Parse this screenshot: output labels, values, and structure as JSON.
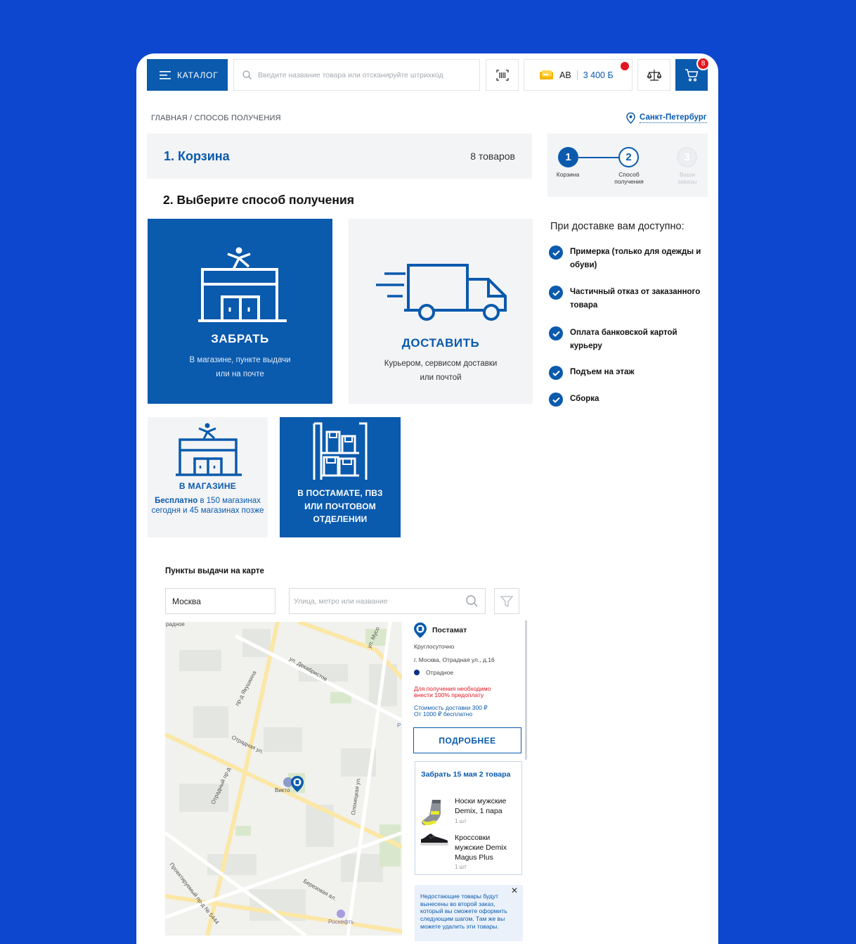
{
  "header": {
    "catalog_label": "КАТАЛОГ",
    "search_placeholder": "Введите название товара или отсканируйте штрихкод",
    "bonus_prefix": "АВ",
    "bonus_value": "3 400 Б",
    "cart_count": "8"
  },
  "breadcrumb": "ГЛАВНАЯ / СПОСОБ ПОЛУЧЕНИЯ",
  "city": "Санкт-Петербург",
  "cart_step": {
    "title": "1. Корзина",
    "count": "8 товаров"
  },
  "choose_title": "2. Выберите способ получения",
  "progress": {
    "steps": [
      {
        "num": "1",
        "label": "Корзина"
      },
      {
        "num": "2",
        "label": "Способ получения"
      },
      {
        "num": "3",
        "label": "Ваши заказы"
      }
    ]
  },
  "options": {
    "pickup": {
      "title": "ЗАБРАТЬ",
      "subtitle_1": "В магазине, пункте выдачи",
      "subtitle_2": "или на почте"
    },
    "delivery": {
      "title": "ДОСТАВИТЬ",
      "subtitle_1": "Курьером, сервисом доставки",
      "subtitle_2": "или почтой"
    }
  },
  "sub_options": {
    "in_store": {
      "title": "В МАГАЗИНЕ",
      "free": "Бесплатно",
      "text": " в 150 магазинах сегодня и 45 магазинах позже"
    },
    "postamat": {
      "title_1": "В ПОСТАМАТЕ, ПВЗ",
      "title_2": "ИЛИ ПОЧТОВОМ",
      "title_3": "ОТДЕЛЕНИИ"
    }
  },
  "benefits": {
    "heading": "При доставке вам доступно:",
    "items": [
      "Примерка (только для одежды и обуви)",
      "Частичный отказ от заказанного товара",
      "Оплата банковской картой курьеру",
      "Подъем на этаж",
      "Сборка"
    ]
  },
  "map_section": {
    "heading": "Пункты выдачи на карте",
    "city_value": "Москва",
    "street_placeholder": "Улица, метро или название",
    "streets": [
      "ул. Декабристов",
      "пр-д Якушкина",
      "Отрадная ул.",
      "Отрадный пр-д",
      "Олонецкая ул.",
      "Березовая ал.",
      "Проектируемый пр-д № 5444",
      "ул. Мусо",
      "радное",
      "Викто",
      "Роснефть",
      "Р"
    ]
  },
  "point": {
    "type": "Постамат",
    "hours": "Круглосуточно",
    "address": "г. Москва, Отрадная ул., д.16",
    "metro": "Отрадное",
    "prepay_1": "Для получения необходимо",
    "prepay_2": "внести 100% предоплату",
    "cost_1": "Стоимость доставки 300 ₽",
    "cost_2": "От 1000 ₽ бесплатно",
    "more_button": "ПОДРОБНЕЕ"
  },
  "order": {
    "title": "Забрать 15 мая 2 товара",
    "items": [
      {
        "name_1": "Носки мужские",
        "name_2": "Demix, 1 пара",
        "qty": "1 шт"
      },
      {
        "name_1": "Кроссовки",
        "name_2": "мужские Demix",
        "name_3": "Magus Plus",
        "qty": "1 шт"
      }
    ]
  },
  "note": "Недостающие товары будут вынесены во второй заказ, который вы сможете оформить следующим шагом. Там же вы можете удалить эти товары."
}
